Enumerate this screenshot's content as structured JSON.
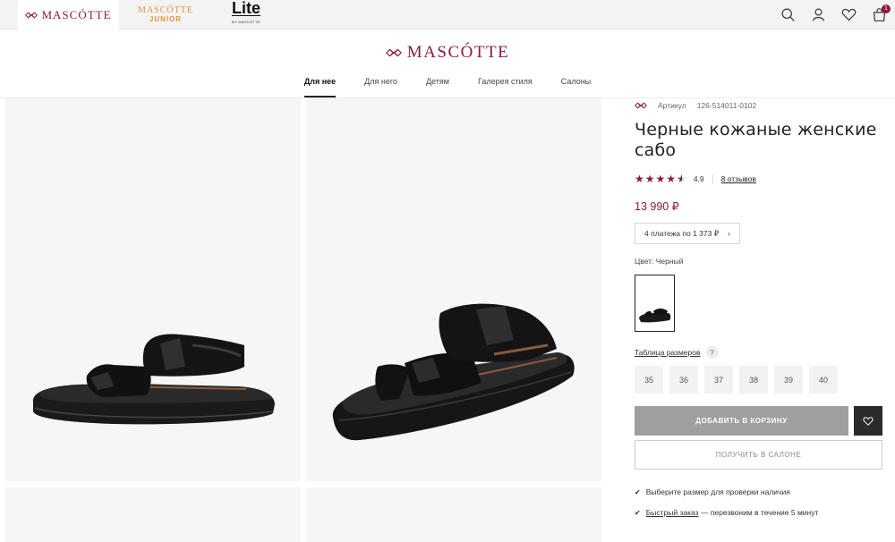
{
  "topbar": {
    "brands": [
      {
        "label": "MASCÓTTE"
      },
      {
        "label_top": "MASCÓTTE",
        "label_bottom": "JUNIOR"
      },
      {
        "label_top": "Lite",
        "label_bottom": "BY MASCÓTTE"
      }
    ],
    "icons": [
      "search-icon",
      "user-icon",
      "heart-icon",
      "cart-icon"
    ],
    "cart_count": "1"
  },
  "header": {
    "logo": "MASCÓTTE",
    "nav": [
      "Для нее",
      "Для него",
      "Детям",
      "Галерея стиля",
      "Салоны"
    ]
  },
  "product": {
    "article_label": "Артикул",
    "article": "126-514011-0102",
    "title": "Черные кожаные женские сабо",
    "rating": "4.9",
    "stars": 4.5,
    "reviews": "8 отзывов",
    "price": "13 990 ₽",
    "installments": "4 платежа по 1 373 ₽",
    "color_label": "Цвет: Черный",
    "size_table": "Таблица размеров",
    "help": "?",
    "sizes": [
      "35",
      "36",
      "37",
      "38",
      "39",
      "40"
    ],
    "add_to_cart": "ДОБАВИТЬ В КОРЗИНУ",
    "get_in_salon": "ПОЛУЧИТЬ В САЛОНЕ",
    "note_1": "Выберите размер для проверки наличия",
    "note_2_link": "Быстрый заказ",
    "note_2_rest": " — перезвоним в течение 5 минут",
    "check": "✔"
  },
  "colors": {
    "brand": "#8a1b3e",
    "button_gray": "#9f9f9f",
    "dark": "#2b2b2b"
  }
}
